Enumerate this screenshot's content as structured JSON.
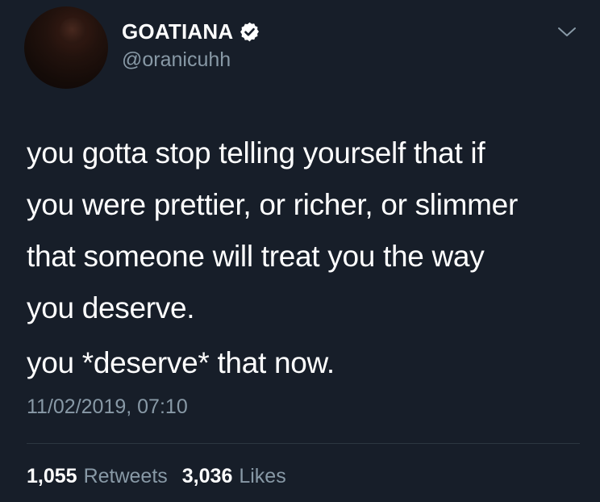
{
  "user": {
    "display_name": "GOATIANA",
    "handle": "@oranicuhh",
    "verified": true
  },
  "tweet": {
    "lines": [
      "you gotta stop telling yourself that if",
      "you were prettier, or richer, or slimmer",
      "that someone will treat you the way",
      "you deserve."
    ],
    "second_paragraph": "you *deserve* that now.",
    "timestamp": "11/02/2019, 07:10"
  },
  "stats": {
    "retweets_count": "1,055",
    "retweets_label": "Retweets",
    "likes_count": "3,036",
    "likes_label": "Likes"
  },
  "colors": {
    "background": "#171e29",
    "text_primary": "#ffffff",
    "text_secondary": "#8899a6",
    "divider": "#2c3640"
  },
  "icons": {
    "verified": "verified-badge-icon",
    "menu": "chevron-down-icon"
  }
}
